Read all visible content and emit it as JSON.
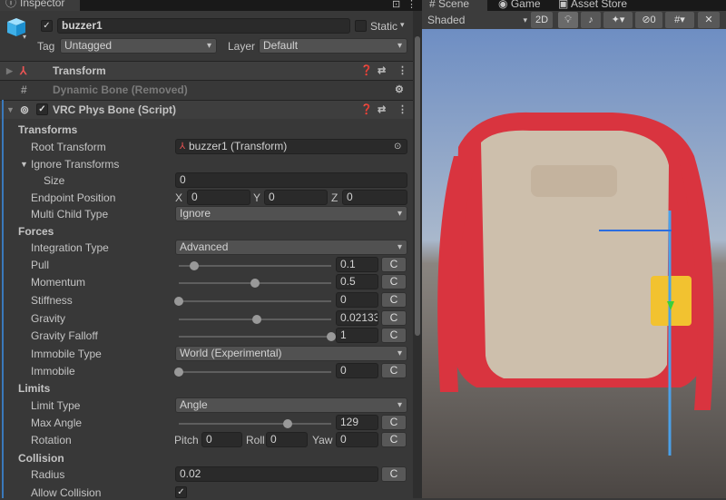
{
  "inspector": {
    "tab": "Inspector",
    "object_name": "buzzer1",
    "static_label": "Static",
    "tag_label": "Tag",
    "tag_value": "Untagged",
    "layer_label": "Layer",
    "layer_value": "Default",
    "components": [
      {
        "name": "Transform"
      },
      {
        "name": "Dynamic Bone (Removed)"
      },
      {
        "name": "VRC Phys Bone (Script)"
      }
    ],
    "rows": [
      {
        "type": "section",
        "label": "Transforms"
      },
      {
        "type": "object",
        "label": "Root Transform",
        "value": "buzzer1 (Transform)"
      },
      {
        "type": "foldout",
        "label": "Ignore Transforms"
      },
      {
        "type": "field",
        "label": "Size",
        "value": "0",
        "indent": true
      },
      {
        "type": "vec3",
        "label": "Endpoint Position",
        "x": "0",
        "y": "0",
        "z": "0"
      },
      {
        "type": "dropdown",
        "label": "Multi Child Type",
        "value": "Ignore"
      },
      {
        "type": "section",
        "label": "Forces"
      },
      {
        "type": "dropdown",
        "label": "Integration Type",
        "value": "Advanced"
      },
      {
        "type": "slider",
        "label": "Pull",
        "value": "0.1",
        "fraction": 0.1
      },
      {
        "type": "slider",
        "label": "Momentum",
        "value": "0.5",
        "fraction": 0.5
      },
      {
        "type": "slider",
        "label": "Stiffness",
        "value": "0",
        "fraction": 0
      },
      {
        "type": "slider",
        "label": "Gravity",
        "value": "0.02133",
        "fraction": 0.51
      },
      {
        "type": "slider",
        "label": "Gravity Falloff",
        "value": "1",
        "fraction": 1
      },
      {
        "type": "dropdown",
        "label": "Immobile Type",
        "value": "World (Experimental)"
      },
      {
        "type": "slider",
        "label": "Immobile",
        "value": "0",
        "fraction": 0
      },
      {
        "type": "section",
        "label": "Limits"
      },
      {
        "type": "dropdown",
        "label": "Limit Type",
        "value": "Angle"
      },
      {
        "type": "slider",
        "label": "Max Angle",
        "value": "129",
        "fraction": 0.717
      },
      {
        "type": "rot",
        "label": "Rotation",
        "pitch": "0",
        "roll": "0",
        "yaw": "0"
      },
      {
        "type": "section",
        "label": "Collision"
      },
      {
        "type": "fieldc",
        "label": "Radius",
        "value": "0.02"
      },
      {
        "type": "check",
        "label": "Allow Collision",
        "checked": true
      }
    ],
    "c_label": "C",
    "axis": {
      "x": "X",
      "y": "Y",
      "z": "Z",
      "pitch": "Pitch",
      "roll": "Roll",
      "yaw": "Yaw"
    }
  },
  "scene": {
    "tabs": [
      "Scene",
      "Game",
      "Asset Store"
    ],
    "shading": "Shaded",
    "mode_2d": "2D",
    "hidden_count": "0"
  }
}
